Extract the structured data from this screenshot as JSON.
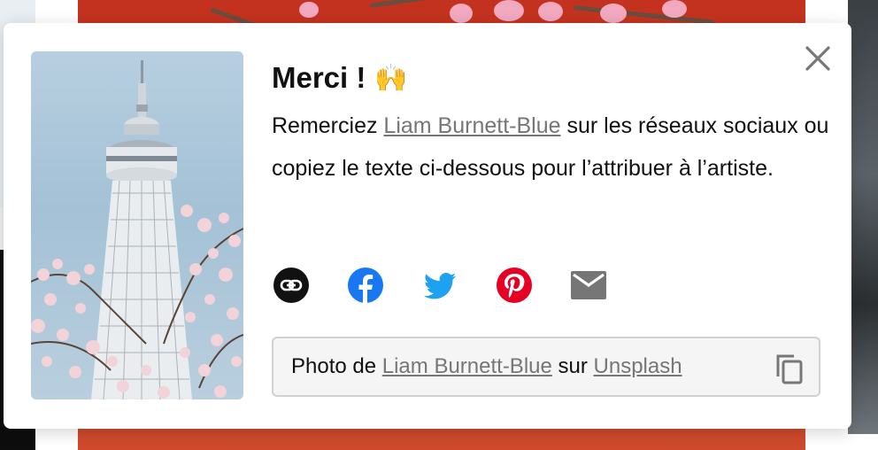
{
  "modal": {
    "title": "Merci !",
    "title_emoji": "🙌",
    "description": {
      "before": "Remerciez ",
      "author_link": "Liam Burnett-Blue",
      "after": " sur les réseaux sociaux ou copiez le texte ci-dessous pour l’attribuer à l’artiste."
    },
    "share_buttons": [
      {
        "name": "copy-link",
        "icon": "link-icon",
        "color": "#111111"
      },
      {
        "name": "facebook",
        "icon": "facebook-icon",
        "color": "#1877f2"
      },
      {
        "name": "twitter",
        "icon": "twitter-icon",
        "color": "#1da1f2"
      },
      {
        "name": "pinterest",
        "icon": "pinterest-icon",
        "color": "#e60023"
      },
      {
        "name": "email",
        "icon": "mail-icon",
        "color": "#767676"
      }
    ],
    "credit": {
      "prefix": "Photo de ",
      "author": "Liam Burnett-Blue",
      "middle": " sur ",
      "site": "Unsplash"
    },
    "close_icon": "close-icon",
    "copy_icon": "copy-icon"
  }
}
